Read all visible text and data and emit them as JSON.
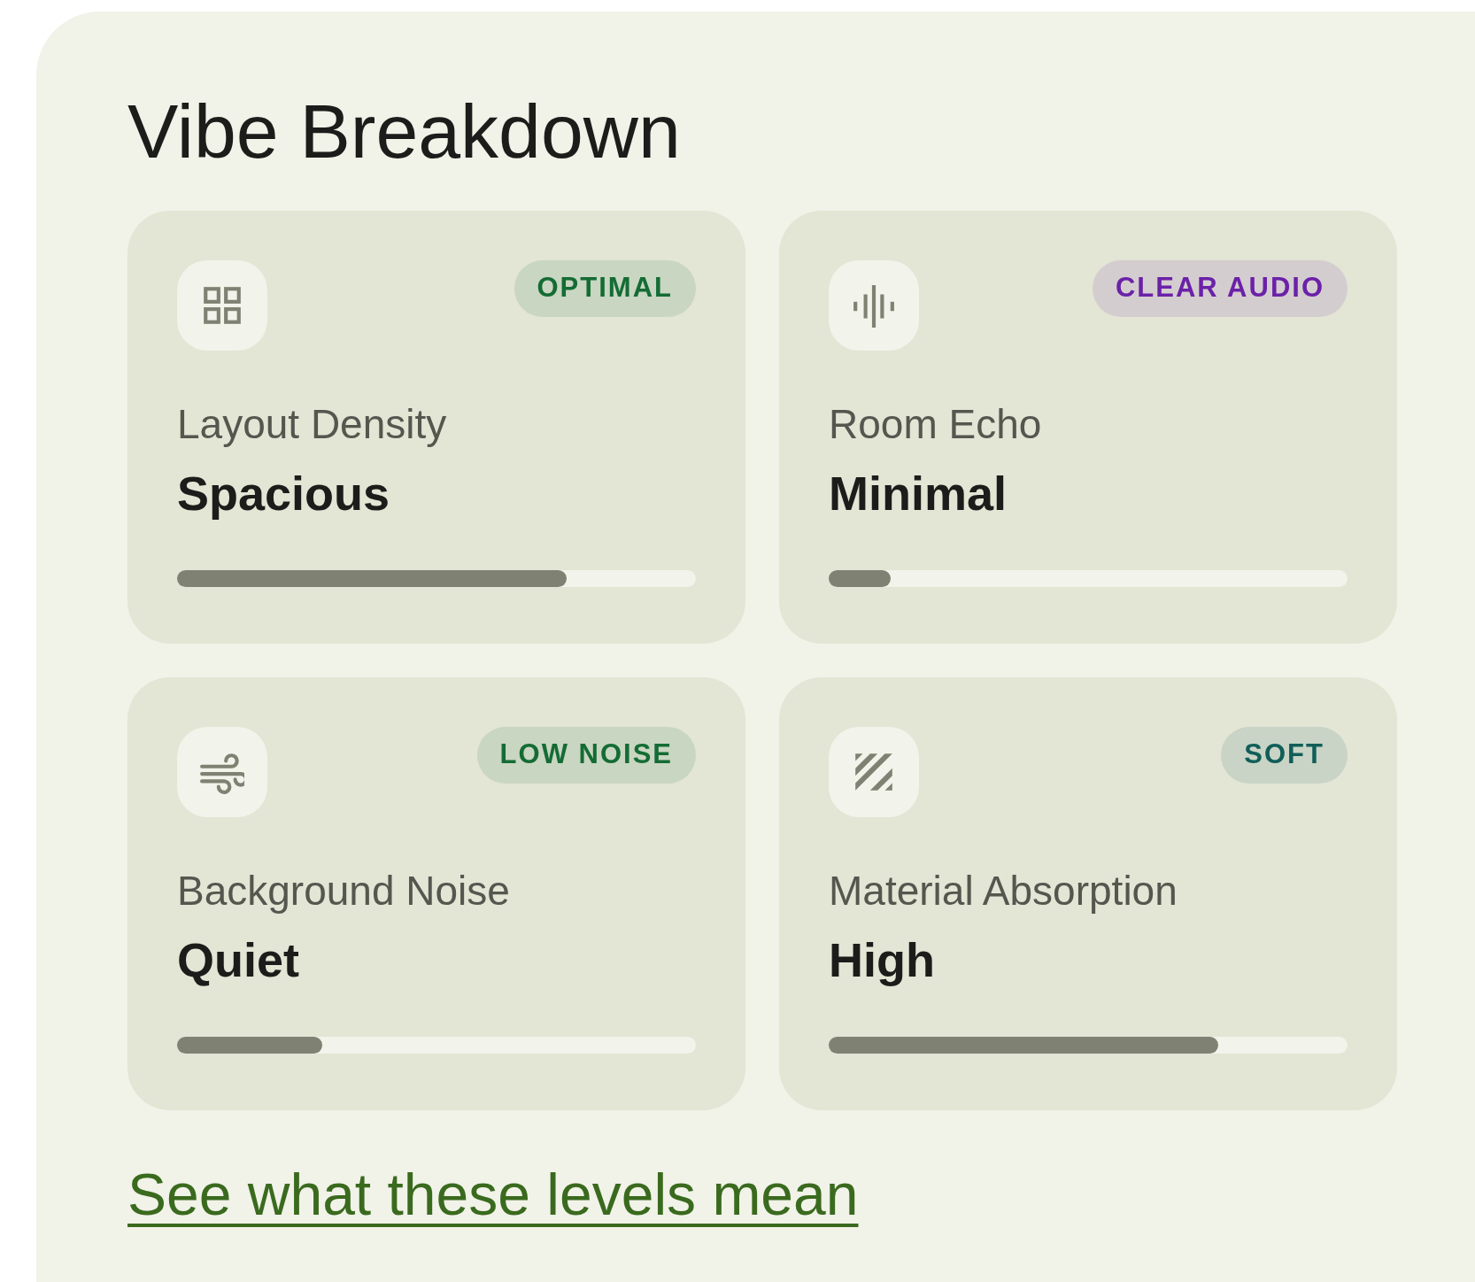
{
  "title": "Vibe Breakdown",
  "metrics": [
    {
      "kind": "grid",
      "badge": "OPTIMAL",
      "color": "#146c34",
      "label": "Layout Density",
      "value": "Spacious",
      "level": 0.75
    },
    {
      "kind": "waveform",
      "badge": "CLEAR AUDIO",
      "color": "#6b21a8",
      "label": "Room Echo",
      "value": "Minimal",
      "level": 0.12
    },
    {
      "kind": "wind",
      "badge": "LOW NOISE",
      "color": "#146c34",
      "label": "Background Noise",
      "value": "Quiet",
      "level": 0.28
    },
    {
      "kind": "stripes",
      "badge": "SOFT",
      "color": "#115e59",
      "label": "Material Absorption",
      "value": "High",
      "level": 0.75
    }
  ],
  "link": "See what these levels mean"
}
